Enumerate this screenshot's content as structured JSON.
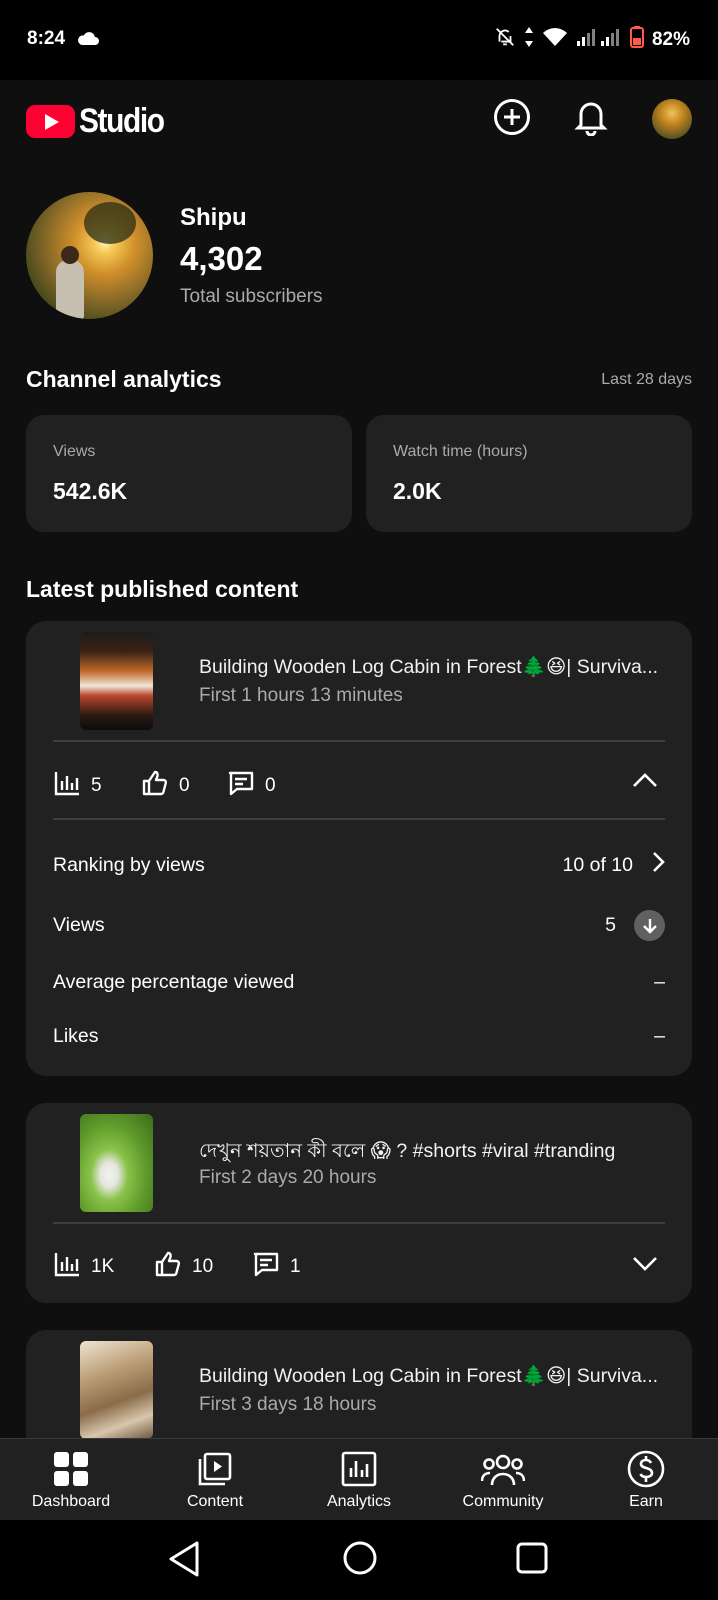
{
  "status_bar": {
    "time": "8:24",
    "battery": "82%"
  },
  "app_bar": {
    "logo_text": "Studio"
  },
  "channel": {
    "name": "Shipu",
    "subscribers": "4,302",
    "subscribers_label": "Total subscribers"
  },
  "analytics": {
    "title": "Channel analytics",
    "period": "Last 28 days",
    "cards": [
      {
        "label": "Views",
        "value": "542.6K"
      },
      {
        "label": "Watch time (hours)",
        "value": "2.0K"
      }
    ]
  },
  "latest": {
    "title": "Latest published content",
    "items": [
      {
        "title": "Building Wooden Log Cabin in Forest🌲😆| Surviva...",
        "subtitle": "First 1 hours 13 minutes",
        "views": "5",
        "likes": "0",
        "comments": "0",
        "expanded": true,
        "details": [
          {
            "label": "Ranking by views",
            "value": "10 of 10"
          },
          {
            "label": "Views",
            "value": "5"
          },
          {
            "label": "Average percentage viewed",
            "value": "–"
          },
          {
            "label": "Likes",
            "value": "–"
          }
        ]
      },
      {
        "title": "দেখুন শয়তান কী বলে 😱 ? #shorts #viral #tranding",
        "subtitle": "First 2 days 20 hours",
        "views": "1K",
        "likes": "10",
        "comments": "1",
        "expanded": false
      },
      {
        "title": "Building Wooden Log Cabin in Forest🌲😆| Surviva...",
        "subtitle": "First 3 days 18 hours"
      }
    ]
  },
  "bottom_nav": [
    {
      "label": "Dashboard",
      "icon": "dashboard-icon"
    },
    {
      "label": "Content",
      "icon": "content-icon"
    },
    {
      "label": "Analytics",
      "icon": "analytics-icon"
    },
    {
      "label": "Community",
      "icon": "community-icon"
    },
    {
      "label": "Earn",
      "icon": "earn-icon"
    }
  ],
  "colors": {
    "background": "#0f0f0f",
    "card": "#212121",
    "brand_red": "#ff0033",
    "secondary_text": "#aaaaaa"
  }
}
